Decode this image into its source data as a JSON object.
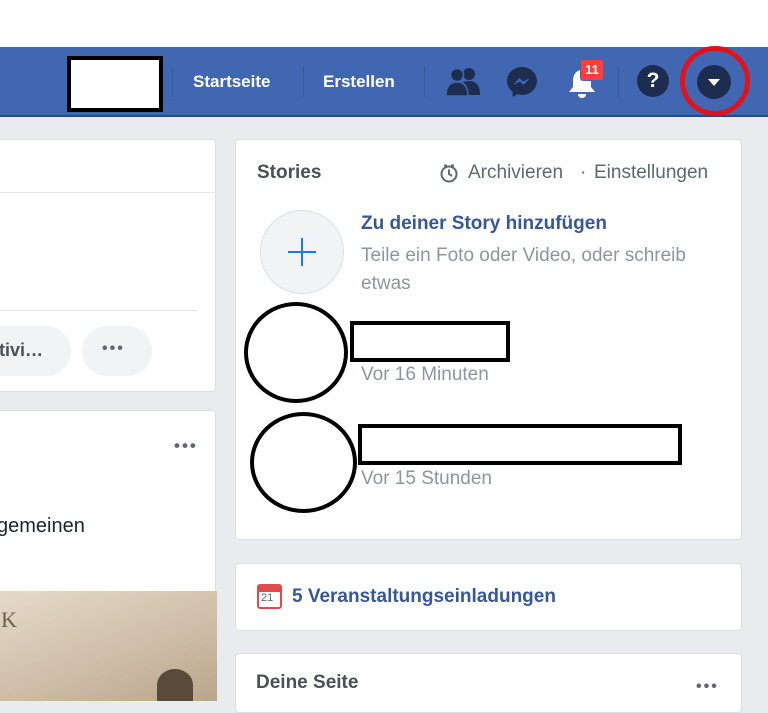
{
  "navbar": {
    "home_label": "Startseite",
    "create_label": "Erstellen",
    "notifications_count": "11",
    "help_label": "?"
  },
  "left": {
    "chip_label": "tivi…",
    "post_dots": "•••",
    "post_text": "gemeinen",
    "photo_letter": "K"
  },
  "stories": {
    "title": "Stories",
    "archive_label": "Archivieren",
    "separator": "·",
    "settings_label": "Einstellungen",
    "add_title": "Zu deiner Story hinzufügen",
    "add_desc": "Teile ein Foto oder Video, oder schreib etwas",
    "items": [
      {
        "time": "Vor 16 Minuten"
      },
      {
        "time": "Vor 15 Stunden"
      }
    ]
  },
  "events": {
    "calendar_day": "21",
    "label": "5 Veranstaltungseinladungen"
  },
  "page_section": {
    "title": "Deine Seite",
    "dots": "•••"
  },
  "colors": {
    "navbar": "#4267b2",
    "badge": "#fa3e3e",
    "highlight": "#e0121b",
    "link": "#365899"
  }
}
